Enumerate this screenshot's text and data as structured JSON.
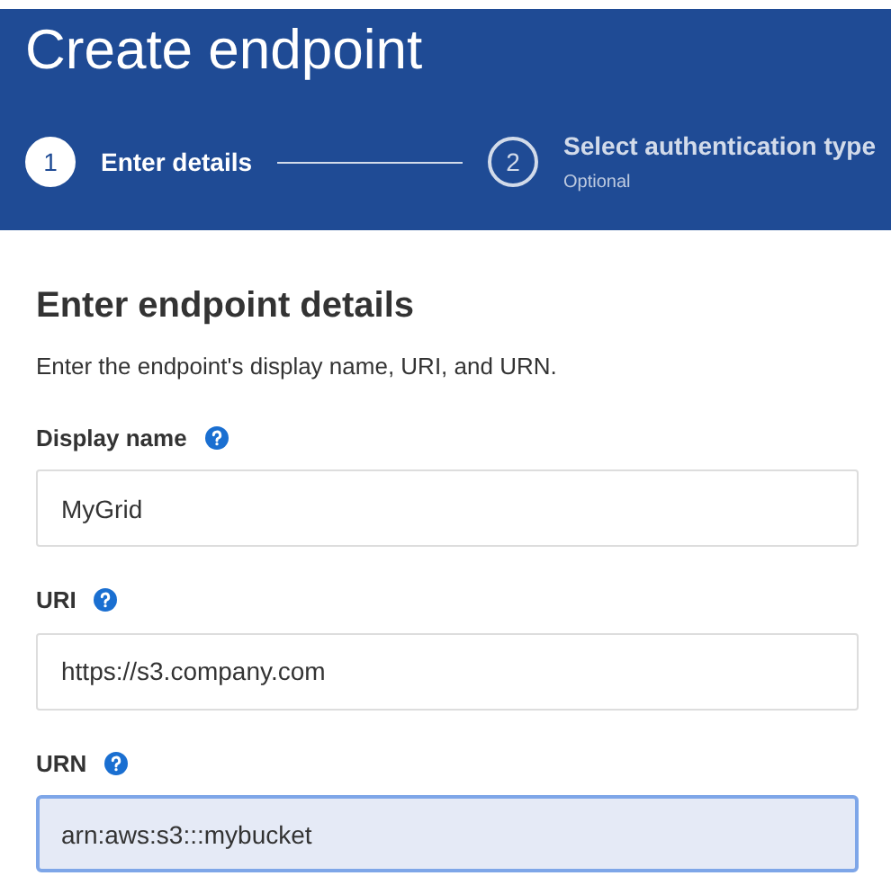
{
  "header": {
    "title": "Create endpoint"
  },
  "steps": [
    {
      "number": "1",
      "label": "Enter details",
      "selected": true
    },
    {
      "number": "2",
      "label": "Select authentication type",
      "sublabel": "Optional",
      "selected": false
    }
  ],
  "section": {
    "heading": "Enter endpoint details",
    "description": "Enter the endpoint's display name, URI, and URN."
  },
  "fields": [
    {
      "label": "Display name",
      "value": "MyGrid",
      "focused": false
    },
    {
      "label": "URI",
      "value": "https://s3.company.com",
      "focused": false
    },
    {
      "label": "URN",
      "value": "arn:aws:s3:::mybucket",
      "focused": true
    }
  ]
}
